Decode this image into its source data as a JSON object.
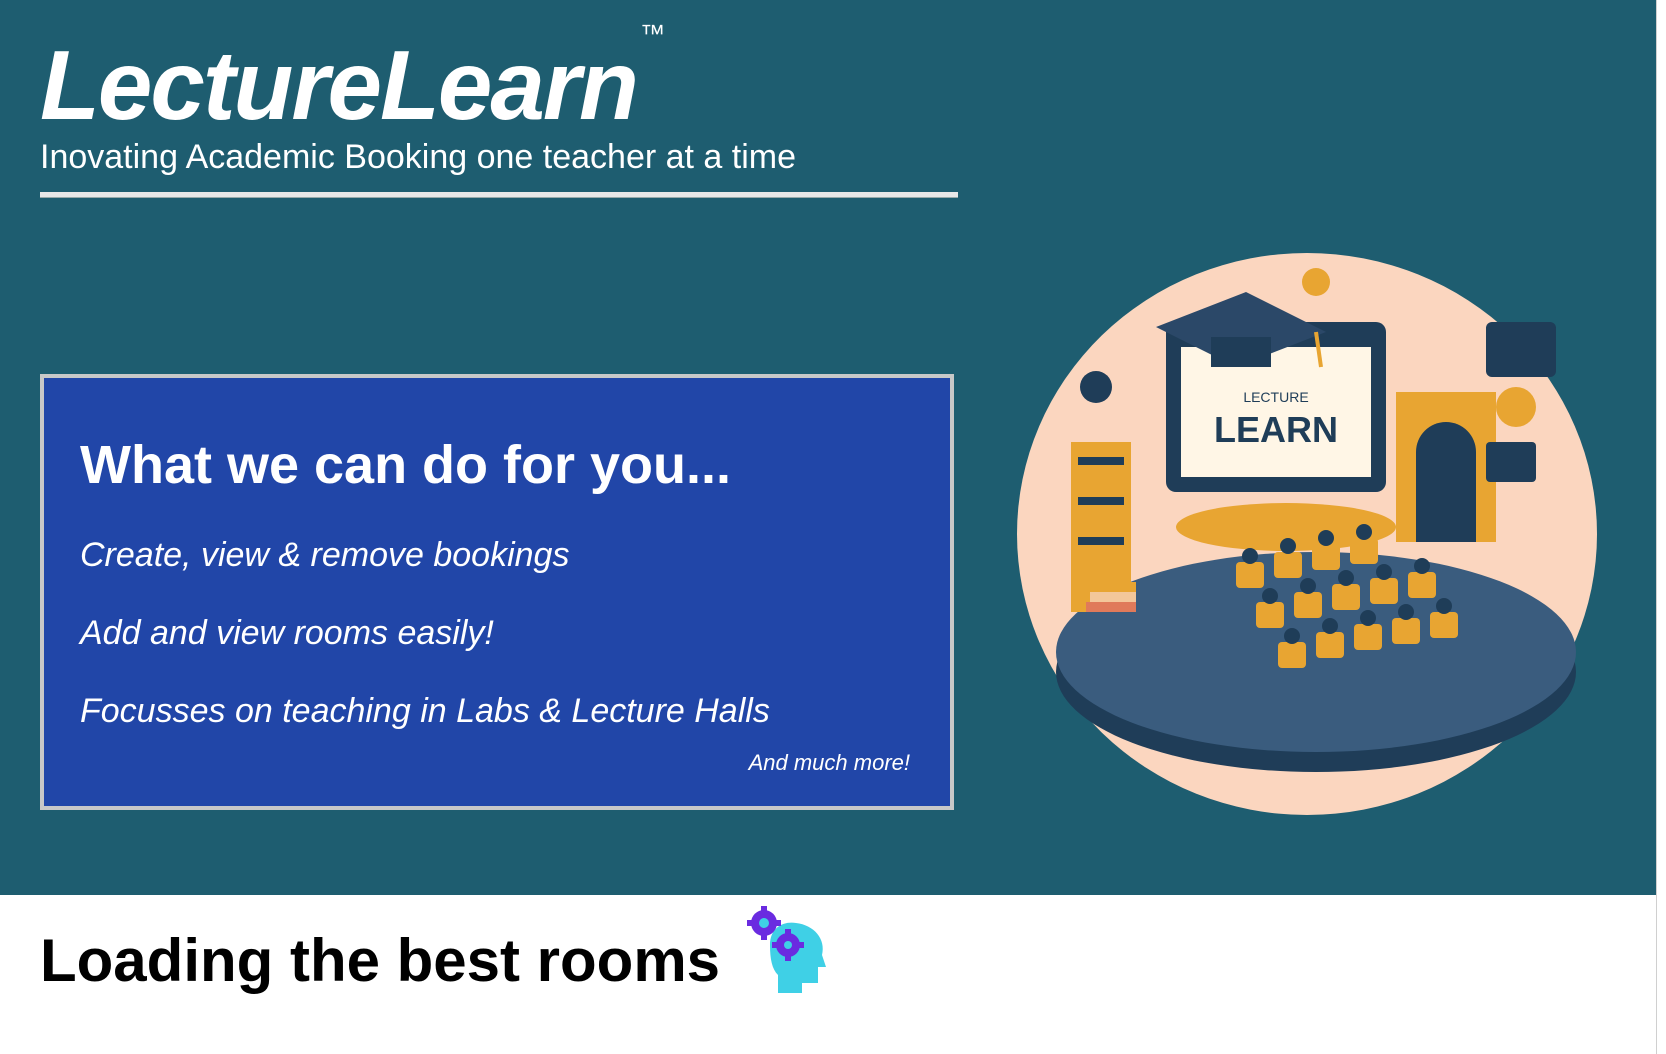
{
  "brand": {
    "name": "LectureLearn",
    "trademark": "™",
    "tagline": "Inovating Academic Booking one teacher at a time"
  },
  "features": {
    "title": "What we can do for you...",
    "items": [
      "Create, view & remove bookings",
      "Add and view rooms easily!",
      "Focusses on teaching in Labs & Lecture Halls"
    ],
    "more": "And much more!"
  },
  "illustration": {
    "screen_small": "LECTURE",
    "screen_large": "LEARN"
  },
  "loading": {
    "text": "Loading the best rooms",
    "icon": "brain-gears-icon"
  },
  "colors": {
    "hero_background": "#1e5d70",
    "card_background": "#2146a8",
    "card_border": "#c8c8c8",
    "illustration_background": "#fbd6bf",
    "accent_gold": "#e8a532",
    "icon_cyan": "#3fd0e6",
    "icon_purple": "#6a2be0"
  }
}
